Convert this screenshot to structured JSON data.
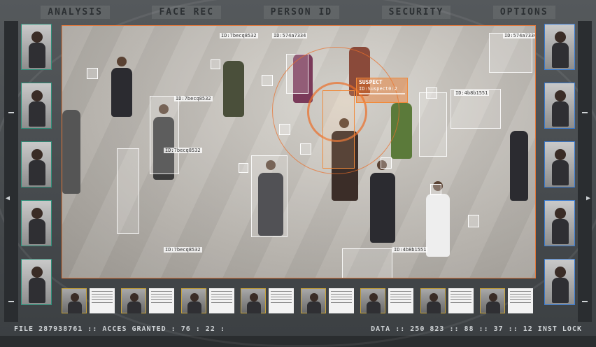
{
  "menu": {
    "tabs": [
      "ANALYSIS",
      "FACE REC",
      "PERSON ID",
      "SECURITY",
      "OPTIONS"
    ]
  },
  "scene": {
    "suspect_title": "SUSPECT",
    "suspect_code": "ID:Suspect0:2",
    "id_labels": [
      "ID:7becq8532",
      "ID:574a7334",
      "ID:7becq8532",
      "ID:7becq8532",
      "ID:574a7334",
      "ID:4b8b1551",
      "ID:7becq8532",
      "ID:4b8b1551"
    ]
  },
  "status": {
    "left_text": "FILE 287938761 :: ACCES GRANTED : 76 : 22 :",
    "right_text": "DATA :: 250 823 :: 88 :: 37 :: 12 INST LOCK"
  },
  "colors": {
    "accent": "#e47a3c",
    "left_thumb_border": "#2e8f7a",
    "right_thumb_border": "#3a7bd0",
    "card_border": "#c9a43c"
  }
}
